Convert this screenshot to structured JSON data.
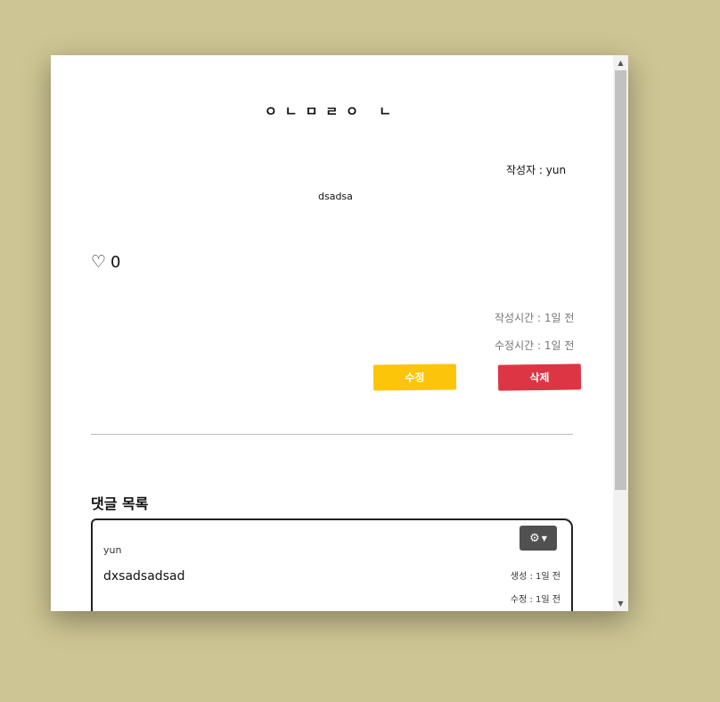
{
  "post": {
    "logo": "ㅇㄴㅁㄹㅇ ㄴ",
    "author": "작성자 : yun",
    "body": "dsadsa",
    "likes": "0",
    "created": "작성시간 : 1일 전",
    "updated": "수정시간 : 1일 전",
    "edit_label": "수정",
    "delete_label": "삭제"
  },
  "comments": {
    "title": "댓글 목록",
    "items": [
      {
        "author": "yun",
        "text": "dxsadsadsad",
        "created": "생성 : 1일 전",
        "updated": "수정 : 1일 전"
      }
    ]
  },
  "colors": {
    "background": "#cdc593",
    "edit": "#fdc50a",
    "delete": "#de3545",
    "gear_button": "#505050"
  },
  "icons": {
    "like": "heart-outline-icon",
    "settings": "gear-icon",
    "dropdown": "caret-down-icon"
  }
}
